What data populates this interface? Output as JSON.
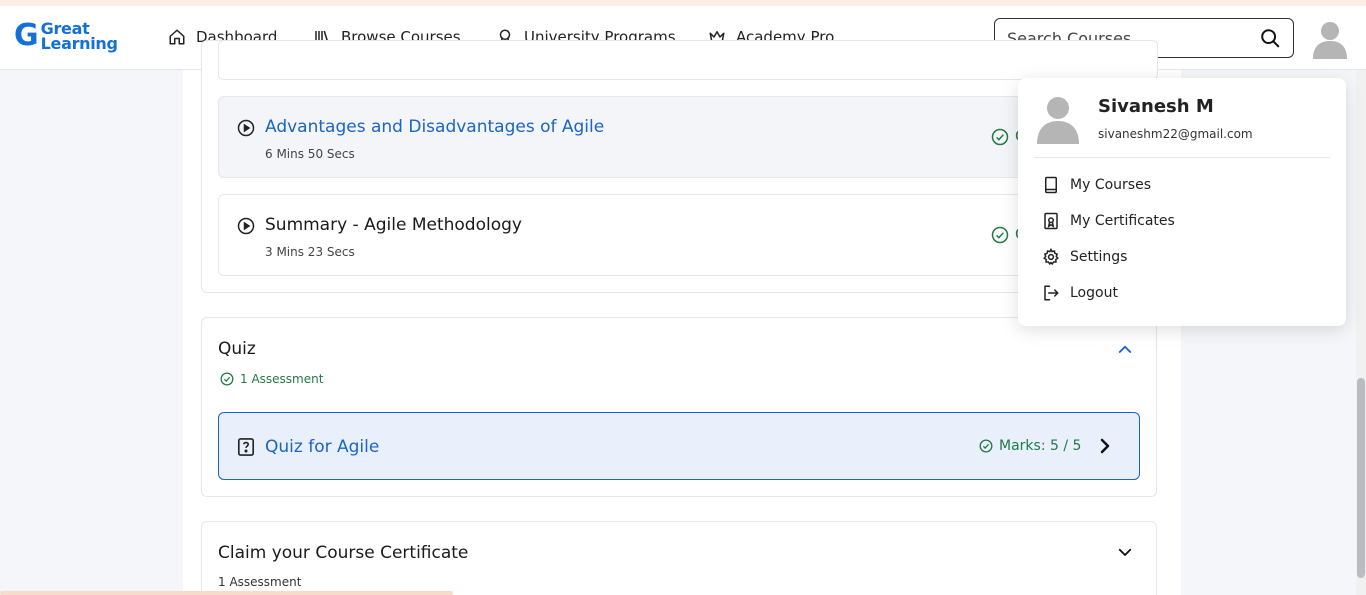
{
  "logo": {
    "mark": "G",
    "line1": "Great",
    "line2": "Learning"
  },
  "nav": {
    "items": [
      {
        "label": "Dashboard",
        "icon": "home-icon"
      },
      {
        "label": "Browse Courses",
        "icon": "library-icon"
      },
      {
        "label": "University Programs",
        "icon": "award-icon"
      },
      {
        "label": "Academy Pro",
        "icon": "crown-icon"
      }
    ],
    "search_placeholder": "Search Courses"
  },
  "lessons": [
    {
      "title": "Advantages and Disadvantages of Agile",
      "duration": "6 Mins 50 Secs",
      "status_initial": "C"
    },
    {
      "title": "Summary - Agile Methodology",
      "duration": "3 Mins 23 Secs",
      "status_initial": "C"
    }
  ],
  "quiz": {
    "title": "Quiz",
    "count": "1 Assessment",
    "item_name": "Quiz for Agile",
    "marks": "Marks: 5 / 5"
  },
  "certificate": {
    "title": "Claim your Course Certificate",
    "count": "1 Assessment"
  },
  "profile": {
    "name": "Sivanesh M",
    "email": "sivaneshm22@gmail.com",
    "menu": [
      {
        "label": "My Courses",
        "icon": "book-icon"
      },
      {
        "label": "My Certificates",
        "icon": "certificate-icon"
      },
      {
        "label": "Settings",
        "icon": "gear-icon"
      },
      {
        "label": "Logout",
        "icon": "logout-icon"
      }
    ]
  },
  "colors": {
    "brand": "#1470d8",
    "link": "#1b64c8",
    "success": "#1f7a45",
    "accent": "#fdeee3"
  }
}
